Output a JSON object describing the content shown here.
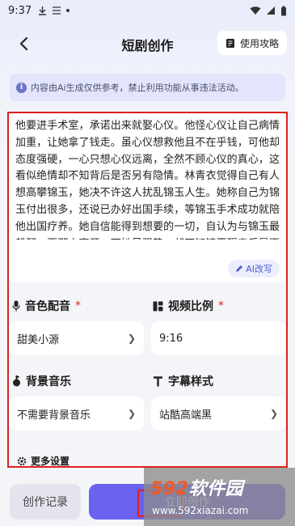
{
  "status_bar": {
    "time": "9:37"
  },
  "nav": {
    "title": "短剧创作",
    "guide_label": "使用攻略"
  },
  "notice": {
    "text": "内容由Ai生成仅供参考，禁止利用功能从事违法活动。"
  },
  "script": {
    "text": "他要进手术室，承诺出来就娶心仪。他怪心仪让自己病情加重，让她拿了钱走。虽心仪想救他且不在乎钱，可他却态度强硬，一心只想心仪远离，全然不顾心仪的真心，这看似绝情却不知背后是否另有隐情。林青衣觉得自己有人想高攀锦玉，她决不许这人扰乱锦玉人生。她称自己为锦玉付出很多，还说已办好出国手续，等锦玉手术成功就陪他出国疗养。她自信能得到想要的一切，自认为与锦玉最般配，要那人离开，可她虽强势，却不知锦玉醒来后是否真会如她所愿，毕",
    "ai_rewrite_label": "AI改写"
  },
  "voice": {
    "label": "音色配音",
    "required_mark": "*",
    "value": "甜美小源"
  },
  "ratio": {
    "label": "视频比例",
    "required_mark": "*",
    "value": "9:16"
  },
  "music": {
    "label": "背景音乐",
    "value": "不需要背景音乐"
  },
  "subtitle": {
    "label": "字幕样式",
    "value": "站酷高端黑"
  },
  "more_settings": {
    "label": "更多设置"
  },
  "bottom": {
    "history_label": "创作记录",
    "create_label": "立即创作"
  },
  "watermark": {
    "brand_num": "592",
    "brand_text": "软件园",
    "url": "www.592xiazai.com"
  },
  "colors": {
    "accent": "#6a63f0",
    "highlight_border": "#e02020"
  }
}
